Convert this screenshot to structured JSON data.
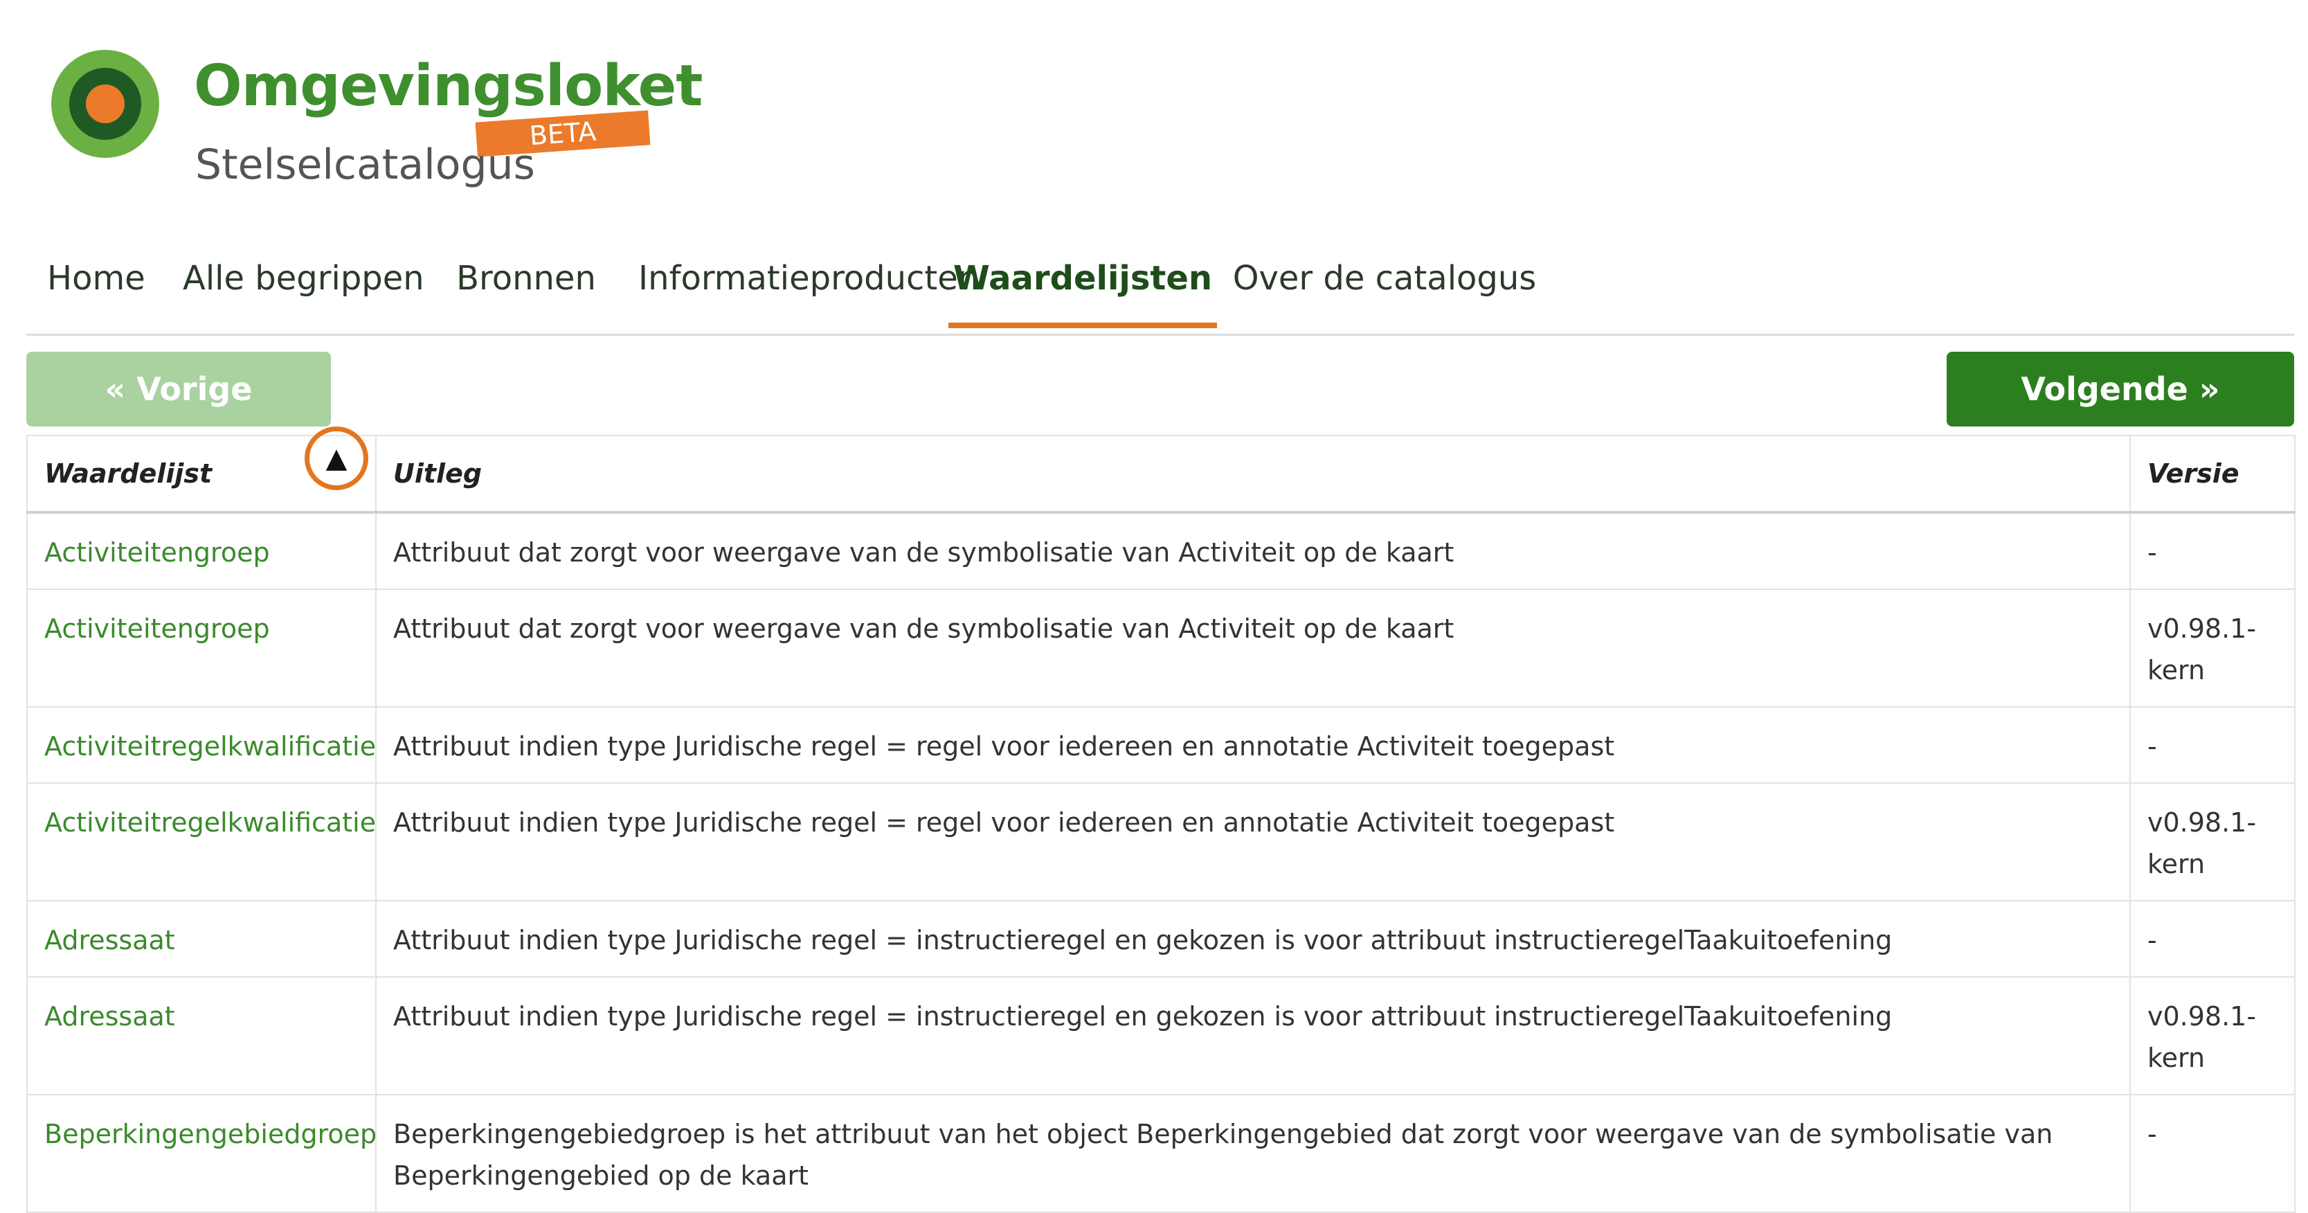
{
  "logo": {
    "title": "Omgevingsloket",
    "badge": "BETA",
    "subtitle": "Stelselcatalogus",
    "colors": {
      "outer": "#6bb043",
      "middle": "#1f5a25",
      "inner": "#ec7a2b"
    }
  },
  "nav": {
    "items": [
      {
        "label": "Home",
        "active": false
      },
      {
        "label": "Alle begrippen",
        "active": false
      },
      {
        "label": "Bronnen",
        "active": false
      },
      {
        "label": "Informatieproducten",
        "active": false
      },
      {
        "label": "Waardelijsten",
        "active": true
      },
      {
        "label": "Over de catalogus",
        "active": false
      }
    ]
  },
  "pager": {
    "prev_label": "« Vorige",
    "next_label": "Volgende »"
  },
  "table": {
    "columns": [
      "Waardelijst",
      "Uitleg",
      "Versie"
    ],
    "sort_icon": "sort-ascending-triangle",
    "sort_glyph": "▲",
    "rows": [
      {
        "name": "Activiteitengroep",
        "uitleg": "Attribuut dat zorgt voor weergave van de symbolisatie van Activiteit op de kaart",
        "versie": "-"
      },
      {
        "name": "Activiteitengroep",
        "uitleg": "Attribuut dat zorgt voor weergave van de symbolisatie van Activiteit op de kaart",
        "versie": "v0.98.1-kern"
      },
      {
        "name": "Activiteitregelkwalificatie",
        "uitleg": "Attribuut indien type Juridische regel = regel voor iedereen en annotatie Activiteit toegepast",
        "versie": "-"
      },
      {
        "name": "Activiteitregelkwalificatie",
        "uitleg": "Attribuut indien type Juridische regel = regel voor iedereen en annotatie Activiteit toegepast",
        "versie": "v0.98.1-kern"
      },
      {
        "name": "Adressaat",
        "uitleg": "Attribuut indien type Juridische regel = instructieregel en gekozen is voor attribuut instructieregelTaakuitoefening",
        "versie": "-"
      },
      {
        "name": "Adressaat",
        "uitleg": "Attribuut indien type Juridische regel = instructieregel en gekozen is voor attribuut instructieregelTaakuitoefening",
        "versie": "v0.98.1-kern"
      },
      {
        "name": "Beperkingengebiedgroep",
        "uitleg": "Beperkingengebiedgroep is het attribuut van het object Beperkingengebied dat zorgt voor weergave van de symbolisatie van Beperkingengebied op de kaart",
        "versie": "-"
      }
    ]
  }
}
